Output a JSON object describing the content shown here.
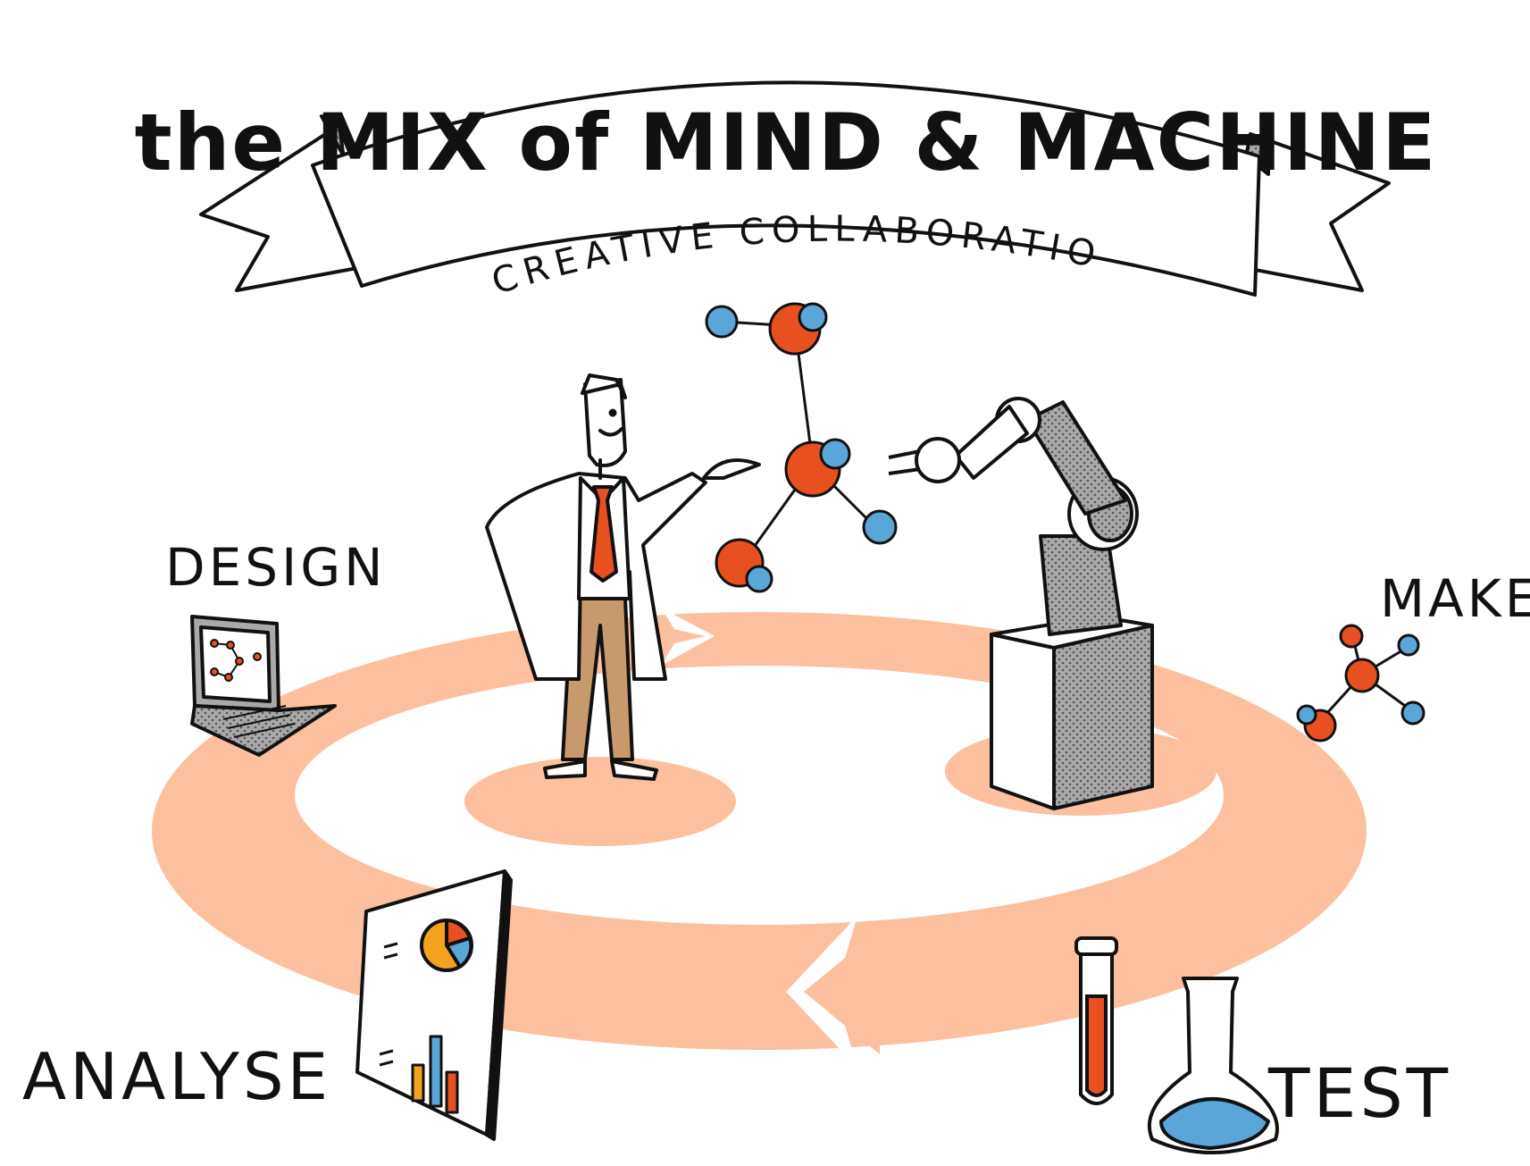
{
  "title": {
    "main": "the MIX of MIND & MACHINE",
    "subtitle": "A CREATIVE COLLABORATION"
  },
  "stages": {
    "design": "DESIGN",
    "make": "MAKE",
    "test": "TEST",
    "analyse": "ANALYSE"
  },
  "colors": {
    "cycle": "#fcc09e",
    "accent_red": "#e8501f",
    "accent_blue": "#5aa6d9",
    "accent_orange": "#f4a11f",
    "trousers": "#c79a6d",
    "ink": "#111111",
    "grey": "#9b9b9b"
  },
  "icons": {
    "laptop": "laptop-icon",
    "molecule": "molecule-icon",
    "scientist": "scientist-figure",
    "robot": "robot-arm-icon",
    "test_tube": "test-tube-icon",
    "flask": "flask-icon",
    "report": "report-chart-icon"
  }
}
